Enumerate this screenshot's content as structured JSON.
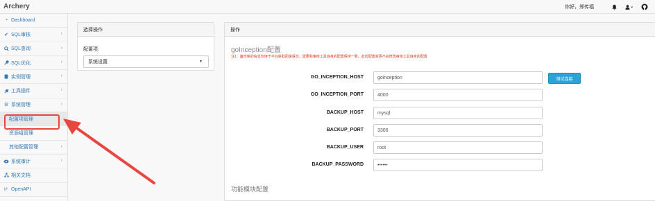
{
  "navbar": {
    "brand": "Archery",
    "greeting": "你好，郑传福",
    "icons": [
      "bell-icon",
      "user-icon",
      "github-icon"
    ]
  },
  "sidebar": {
    "items": [
      {
        "label": "Dashboard",
        "icon": "dashboard-icon",
        "arrow": ""
      },
      {
        "label": "SQL审核",
        "icon": "check-icon",
        "arrow": "‹"
      },
      {
        "label": "SQL查询",
        "icon": "search-icon",
        "arrow": "‹"
      },
      {
        "label": "SQL优化",
        "icon": "wrench-icon",
        "arrow": "‹"
      },
      {
        "label": "实例管理",
        "icon": "database-icon",
        "arrow": "‹"
      },
      {
        "label": "工具插件",
        "icon": "plug-icon",
        "arrow": "‹"
      },
      {
        "label": "系统管理",
        "icon": "gears-icon",
        "arrow": "‹"
      },
      {
        "label": "配置项管理",
        "icon": "",
        "arrow": ""
      },
      {
        "label": "资源组管理",
        "icon": "",
        "arrow": ""
      },
      {
        "label": "其他配置管理",
        "icon": "",
        "arrow": "‹"
      },
      {
        "label": "系统审计",
        "icon": "eye-icon",
        "arrow": "‹"
      },
      {
        "label": "相关文档",
        "icon": "sitemap-icon",
        "arrow": ""
      },
      {
        "label": "OpenAPI",
        "icon": "api-icon",
        "arrow": ""
      }
    ]
  },
  "left_panel": {
    "heading": "选择操作",
    "label": "配置项:",
    "select_value": "系统设置"
  },
  "right_panel": {
    "heading": "操作",
    "section_title": "goInception配置",
    "note": "注1：备份库的信息仅用于平台获取回滚语句，需要和审核工具自身的配置保持一致，此处配置变更不会修改审核工具自身的配置",
    "test_button": "测试连接",
    "fields": [
      {
        "label": "GO_INCEPTION_HOST",
        "value": "goinception"
      },
      {
        "label": "GO_INCEPTION_PORT",
        "value": "4000"
      },
      {
        "label": "BACKUP_HOST",
        "value": "mysql"
      },
      {
        "label": "BACKUP_PORT",
        "value": "3306"
      },
      {
        "label": "BACKUP_USER",
        "value": "root"
      },
      {
        "label": "BACKUP_PASSWORD",
        "value": "••••••"
      }
    ],
    "section_title_2": "功能模块配置"
  },
  "colors": {
    "link": "#337ab7",
    "note_red": "#d9361e",
    "button_blue": "#2ba3d9",
    "highlight_red": "#e8473e"
  }
}
